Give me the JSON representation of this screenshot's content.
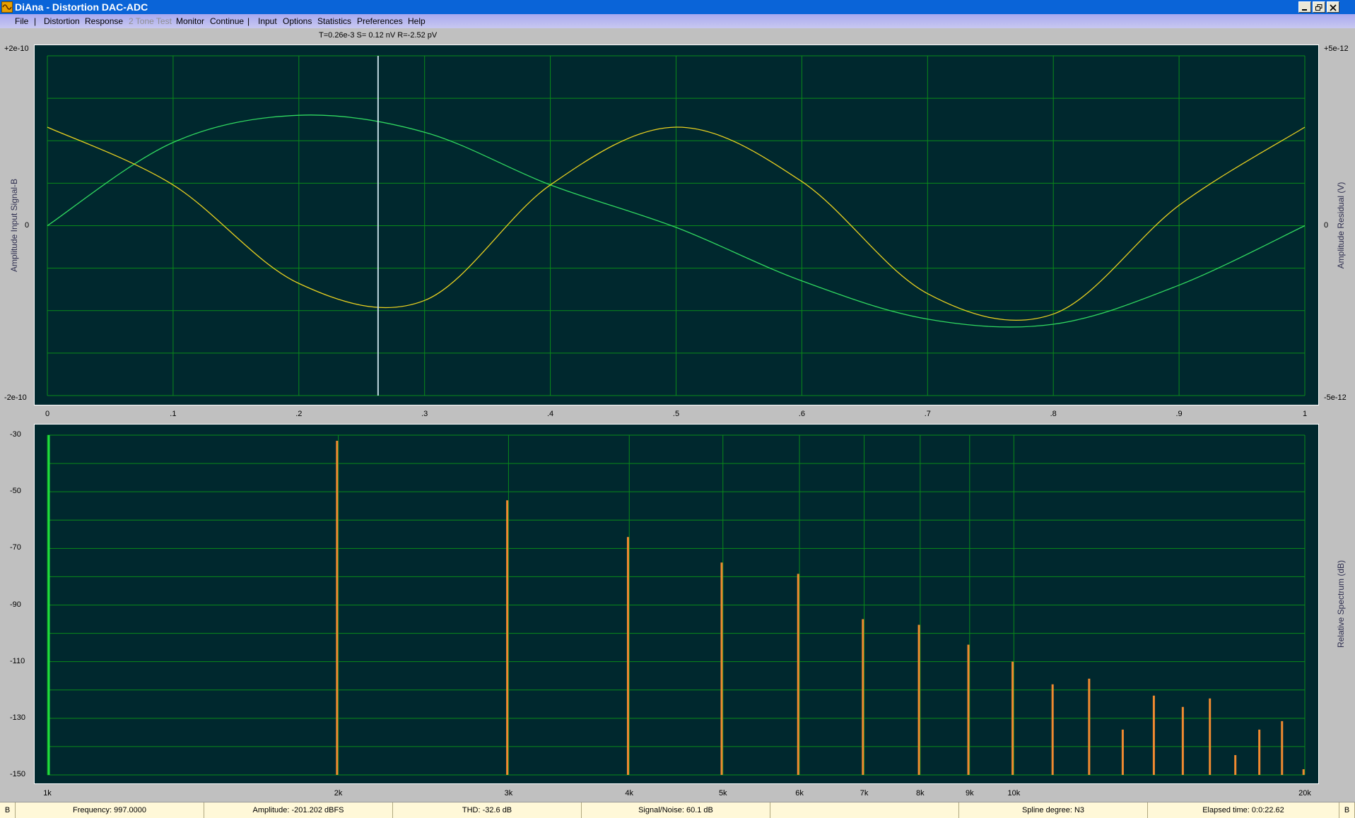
{
  "window": {
    "title": "DiAna - Distortion DAC-ADC"
  },
  "menu": {
    "items": [
      "File",
      "Distortion",
      "Response",
      "2 Tone Test",
      "Monitor",
      "Continue",
      "Input",
      "Options",
      "Statistics",
      "Preferences",
      "Help"
    ],
    "separator": "|"
  },
  "readout": "T=0.26e-3 S= 0.12 nV R=-2.52 pV",
  "top_plot": {
    "y_left_top": "+2e-10",
    "y_left_mid": "0",
    "y_left_bottom": "-2e-10",
    "y_right_top": "+5e-12",
    "y_right_mid": "0",
    "y_right_bottom": "-5e-12",
    "y_left_label": "Amplitude Input Signal-B",
    "y_right_label": "Amplitude Residual (V)",
    "x_ticks": [
      "0",
      ".1",
      ".2",
      ".3",
      ".4",
      ".5",
      ".6",
      ".7",
      ".8",
      ".9",
      "1"
    ],
    "cursor_x": 0.263,
    "colors": {
      "signal": "#30d860",
      "residual": "#e8d020",
      "grid": "#0a8a1a",
      "cursor": "#c0d8e0"
    }
  },
  "bottom_plot": {
    "y_ticks": [
      "-30",
      "-50",
      "-70",
      "-90",
      "-110",
      "-130",
      "-150"
    ],
    "y_right_label": "Relative Spectrum (dB)",
    "x_ticks": [
      "1k",
      "2k",
      "3k",
      "4k",
      "5k",
      "6k",
      "7k",
      "8k",
      "9k",
      "10k",
      "20k"
    ],
    "colors": {
      "bar": "#f08a30",
      "fundamental": "#20e040",
      "grid": "#0a8a1a"
    }
  },
  "chart_data": [
    {
      "type": "line",
      "x": [
        0,
        0.1,
        0.2,
        0.3,
        0.4,
        0.5,
        0.6,
        0.7,
        0.8,
        0.9,
        1.0
      ],
      "xlim": [
        0,
        1
      ],
      "ylim_left": [
        -2e-10,
        2e-10
      ],
      "ylim_right": [
        -5e-12,
        5e-12
      ],
      "series": [
        {
          "axis": "left",
          "values": [
            0,
            9.8e-11,
            1.3e-10,
            1.1e-10,
            4.8e-11,
            -2e-12,
            -6.5e-11,
            -1.1e-10,
            -1.16e-10,
            -7e-11,
            0
          ]
        },
        {
          "axis": "right",
          "values": [
            2.9e-12,
            1.2e-12,
            -1.7e-12,
            -2.2e-12,
            1.2e-12,
            2.9e-12,
            1.3e-12,
            -2e-12,
            -2.6e-12,
            6e-13,
            2.9e-12
          ]
        }
      ],
      "grid": true
    },
    {
      "type": "bar",
      "x_scale": "log",
      "xlim": [
        1000,
        20000
      ],
      "ylim": [
        -150,
        -30
      ],
      "x": [
        997,
        1994,
        2991,
        3988,
        4985,
        5982,
        6979,
        7976,
        8973,
        9970,
        10967,
        11964,
        12961,
        13958,
        14955,
        15952,
        16949,
        17946,
        18943,
        19940
      ],
      "values": [
        -30,
        -32,
        -53,
        -66,
        -75,
        -79,
        -95,
        -97,
        -104,
        -110,
        -118,
        -116,
        -134,
        -122,
        -126,
        -123,
        -143,
        -134,
        -131,
        -148
      ],
      "grid": true
    }
  ],
  "status": {
    "left_letter": "B",
    "frequency": "Frequency: 997.0000",
    "amplitude": "Amplitude: -201.202 dBFS",
    "thd": "THD:  -32.6 dB",
    "signal_noise": "Signal/Noise:   60.1 dB",
    "empty": "",
    "spline": "Spline degree: N3",
    "elapsed": "Elapsed time: 0:0:22.62",
    "right_letter": "B"
  }
}
